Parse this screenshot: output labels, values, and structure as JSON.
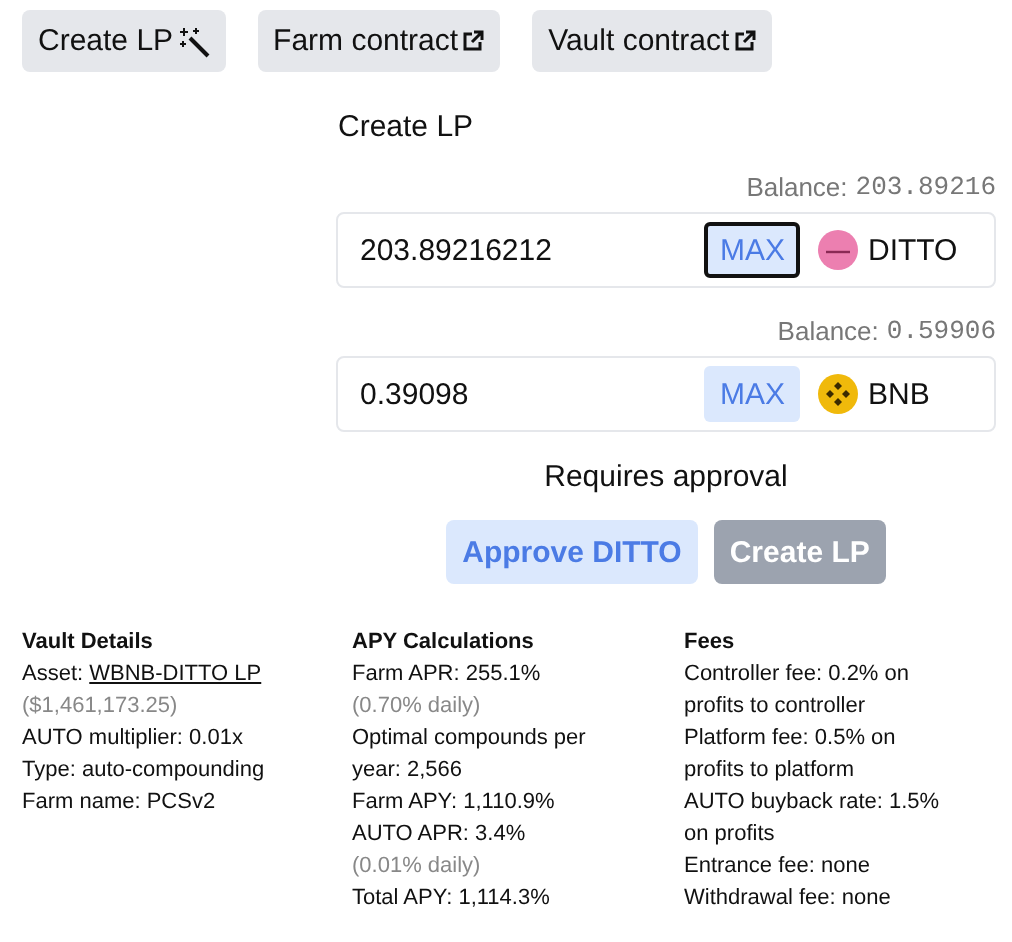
{
  "top_buttons": [
    {
      "label": "Create LP",
      "kind": "wand"
    },
    {
      "label": "Farm contract",
      "kind": "external"
    },
    {
      "label": "Vault contract",
      "kind": "external"
    }
  ],
  "form": {
    "title": "Create LP",
    "inputs": [
      {
        "balance_label": "Balance:",
        "balance": "203.89216",
        "value": "203.89216212",
        "max": "MAX",
        "max_focused": true,
        "token": "DITTO",
        "kind": "ditto"
      },
      {
        "balance_label": "Balance:",
        "balance": "0.59906",
        "value": "0.39098",
        "max": "MAX",
        "max_focused": false,
        "token": "BNB",
        "kind": "bnb"
      }
    ],
    "notice": "Requires approval",
    "actions": [
      {
        "label": "Approve DITTO",
        "disabled": false
      },
      {
        "label": "Create LP",
        "disabled": true
      }
    ]
  },
  "details": [
    {
      "title": "Vault Details",
      "lines": [
        {
          "kind": "link",
          "prefix": "Asset:",
          "text": "WBNB-DITTO LP"
        },
        {
          "kind": "muted",
          "text": "($1,461,173.25)"
        },
        {
          "kind": "plain",
          "text": "AUTO multiplier: 0.01x"
        },
        {
          "kind": "plain",
          "text": "Type: auto-compounding"
        },
        {
          "kind": "plain",
          "text": "Farm name: PCSv2"
        }
      ]
    },
    {
      "title": "APY Calculations",
      "lines": [
        {
          "kind": "plain",
          "text": "Farm APR: 255.1%"
        },
        {
          "kind": "muted",
          "text": "(0.70% daily)"
        },
        {
          "kind": "plain",
          "text": "Optimal compounds per year: 2,566"
        },
        {
          "kind": "plain",
          "text": "Farm APY: 1,110.9%"
        },
        {
          "kind": "plain",
          "text": "AUTO APR: 3.4%"
        },
        {
          "kind": "muted",
          "text": "(0.01% daily)"
        },
        {
          "kind": "plain",
          "text": "Total APY: 1,114.3%"
        }
      ]
    },
    {
      "title": "Fees",
      "lines": [
        {
          "kind": "plain",
          "text": "Controller fee: 0.2% on profits to controller"
        },
        {
          "kind": "plain",
          "text": "Platform fee: 0.5% on profits to platform"
        },
        {
          "kind": "plain",
          "text": "AUTO buyback rate: 1.5% on profits"
        },
        {
          "kind": "plain",
          "text": "Entrance fee: none"
        },
        {
          "kind": "plain",
          "text": "Withdrawal fee: none"
        }
      ]
    }
  ]
}
